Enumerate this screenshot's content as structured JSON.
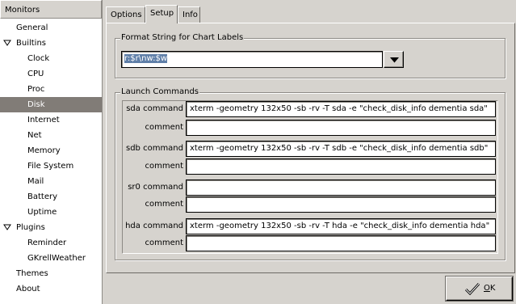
{
  "tree": {
    "header": "Monitors",
    "items": [
      {
        "label": "General",
        "level": 0
      },
      {
        "label": "Builtins",
        "level": 0,
        "expanded": true
      },
      {
        "label": "Clock",
        "level": 1
      },
      {
        "label": "CPU",
        "level": 1
      },
      {
        "label": "Proc",
        "level": 1
      },
      {
        "label": "Disk",
        "level": 1,
        "selected": true
      },
      {
        "label": "Internet",
        "level": 1
      },
      {
        "label": "Net",
        "level": 1
      },
      {
        "label": "Memory",
        "level": 1
      },
      {
        "label": "File System",
        "level": 1
      },
      {
        "label": "Mail",
        "level": 1
      },
      {
        "label": "Battery",
        "level": 1
      },
      {
        "label": "Uptime",
        "level": 1
      },
      {
        "label": "Plugins",
        "level": 0,
        "expanded": true
      },
      {
        "label": "Reminder",
        "level": 1
      },
      {
        "label": "GKrellWeather",
        "level": 1
      },
      {
        "label": "Themes",
        "level": 0
      },
      {
        "label": "About",
        "level": 0
      }
    ]
  },
  "tabs": [
    {
      "label": "Options",
      "active": false
    },
    {
      "label": "Setup",
      "active": true
    },
    {
      "label": "Info",
      "active": false
    }
  ],
  "format": {
    "frame_label": "Format String for Chart Labels",
    "value": "r:$r\\nw:$w"
  },
  "launch": {
    "frame_label": "Launch Commands",
    "rows": [
      {
        "command_label": "sda command",
        "command_value": "xterm -geometry 132x50 -sb -rv -T sda -e \"check_disk_info dementia sda\"",
        "comment_label": "comment",
        "comment_value": ""
      },
      {
        "command_label": "sdb command",
        "command_value": "xterm -geometry 132x50 -sb -rv -T sdb -e \"check_disk_info dementia sdb\"",
        "comment_label": "comment",
        "comment_value": ""
      },
      {
        "command_label": "sr0 command",
        "command_value": "",
        "comment_label": "comment",
        "comment_value": ""
      },
      {
        "command_label": "hda command",
        "command_value": "xterm -geometry 132x50 -sb -rv -T hda -e \"check_disk_info dementia hda\"",
        "comment_label": "comment",
        "comment_value": ""
      }
    ]
  },
  "ok_button": {
    "label_prefix": "",
    "mnemonic": "O",
    "label_rest": "K"
  },
  "colors": {
    "selection": "#817c77",
    "window": "#d6d3ce",
    "text_selection": "#5f7fa8"
  }
}
